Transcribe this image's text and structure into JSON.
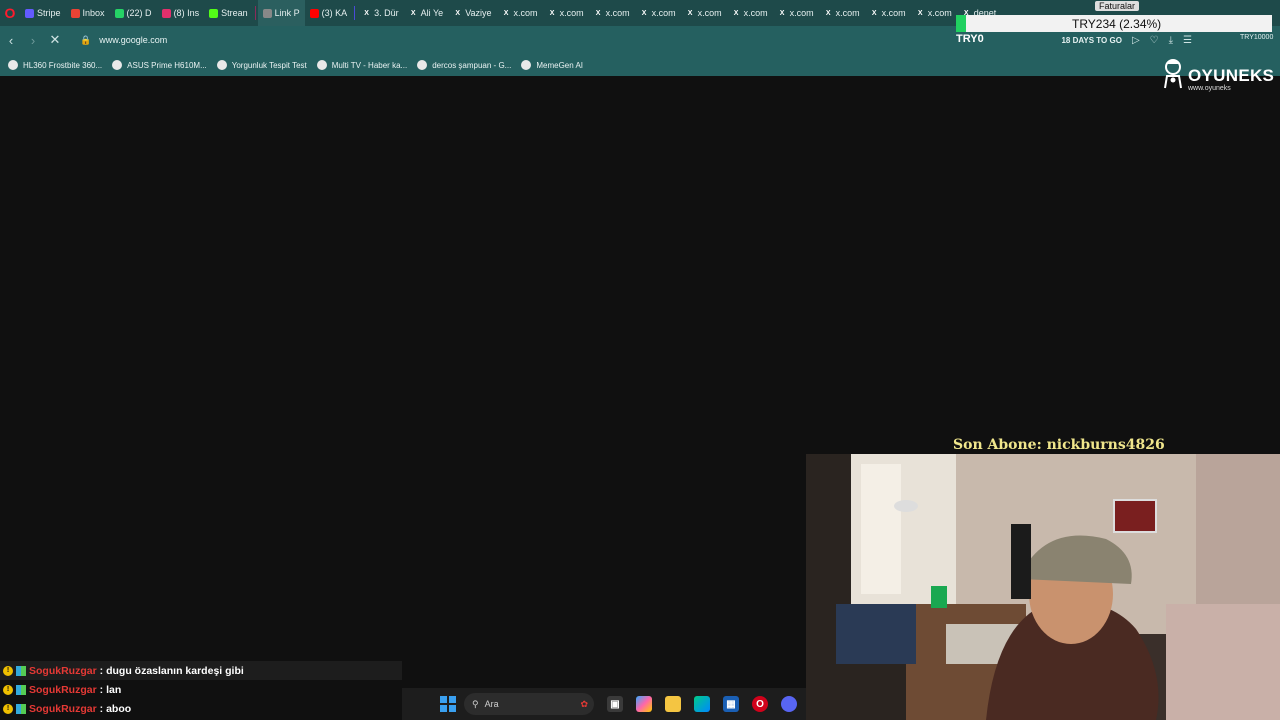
{
  "browser": {
    "tabs": [
      {
        "label": "Stripe",
        "icon": "stripe-icon",
        "color": "#635bff"
      },
      {
        "label": "Inbox",
        "icon": "gmail-icon",
        "color": "#ea4335"
      },
      {
        "label": "(22) D",
        "icon": "whatsapp-icon",
        "color": "#25d366"
      },
      {
        "label": "(8) Ins",
        "icon": "instagram-icon",
        "color": "#e1306c"
      },
      {
        "label": "Strean",
        "icon": "kick-icon",
        "color": "#53fc18"
      },
      {
        "label": "Link P",
        "icon": "link-icon",
        "color": "#888888",
        "active": true
      },
      {
        "label": "(3) KA",
        "icon": "youtube-icon",
        "color": "#ff0000"
      },
      {
        "label": "3. Dür",
        "icon": "x-icon",
        "color": "#000000"
      },
      {
        "label": "Ali Ye",
        "icon": "x-icon",
        "color": "#000000"
      },
      {
        "label": "Vaziye",
        "icon": "x-icon",
        "color": "#000000"
      },
      {
        "label": "x.com",
        "icon": "x-icon",
        "color": "#000000"
      },
      {
        "label": "x.com",
        "icon": "x-icon",
        "color": "#000000"
      },
      {
        "label": "x.com",
        "icon": "x-icon",
        "color": "#000000"
      },
      {
        "label": "x.com",
        "icon": "x-icon",
        "color": "#000000"
      },
      {
        "label": "x.com",
        "icon": "x-icon",
        "color": "#000000"
      },
      {
        "label": "x.com",
        "icon": "x-icon",
        "color": "#000000"
      },
      {
        "label": "x.com",
        "icon": "x-icon",
        "color": "#000000"
      },
      {
        "label": "x.com",
        "icon": "x-icon",
        "color": "#000000"
      },
      {
        "label": "x.com",
        "icon": "x-icon",
        "color": "#000000"
      },
      {
        "label": "x.com",
        "icon": "x-icon",
        "color": "#000000"
      },
      {
        "label": "denet",
        "icon": "x-icon",
        "color": "#000000"
      }
    ],
    "url": "www.google.com",
    "days_text": "18 DAYS TO GO",
    "try_right": "TRY10000",
    "bookmarks": [
      {
        "label": "HL360 Frostbite 360...",
        "icon": "hyperx-icon"
      },
      {
        "label": "ASUS Prime H610M...",
        "icon": "kick-icon"
      },
      {
        "label": "Yorgunluk Tespit Test",
        "icon": "page-icon"
      },
      {
        "label": "Multi TV - Haber ka...",
        "icon": "tv-icon"
      },
      {
        "label": "dercos şampuan - G...",
        "icon": "google-icon"
      },
      {
        "label": "MemeGen AI",
        "icon": "memegen-icon"
      }
    ]
  },
  "overlay": {
    "ticker_value": "TRY234 (2.34%)",
    "ticker_small": "TRY0",
    "faturalar": "Faturalar",
    "oyuneks_name": "OYUNEKS",
    "oyuneks_sub": "www.oyuneks",
    "son_abone": "Son Abone: nickburns4826"
  },
  "chat": [
    {
      "user": "SogukRuzgar",
      "message": ": dugu özaslanın kardeşi gibi"
    },
    {
      "user": "SogukRuzgar",
      "message": ": lan"
    },
    {
      "user": "SogukRuzgar",
      "message": ": aboo"
    }
  ],
  "taskbar": {
    "search_placeholder": "Ara"
  }
}
